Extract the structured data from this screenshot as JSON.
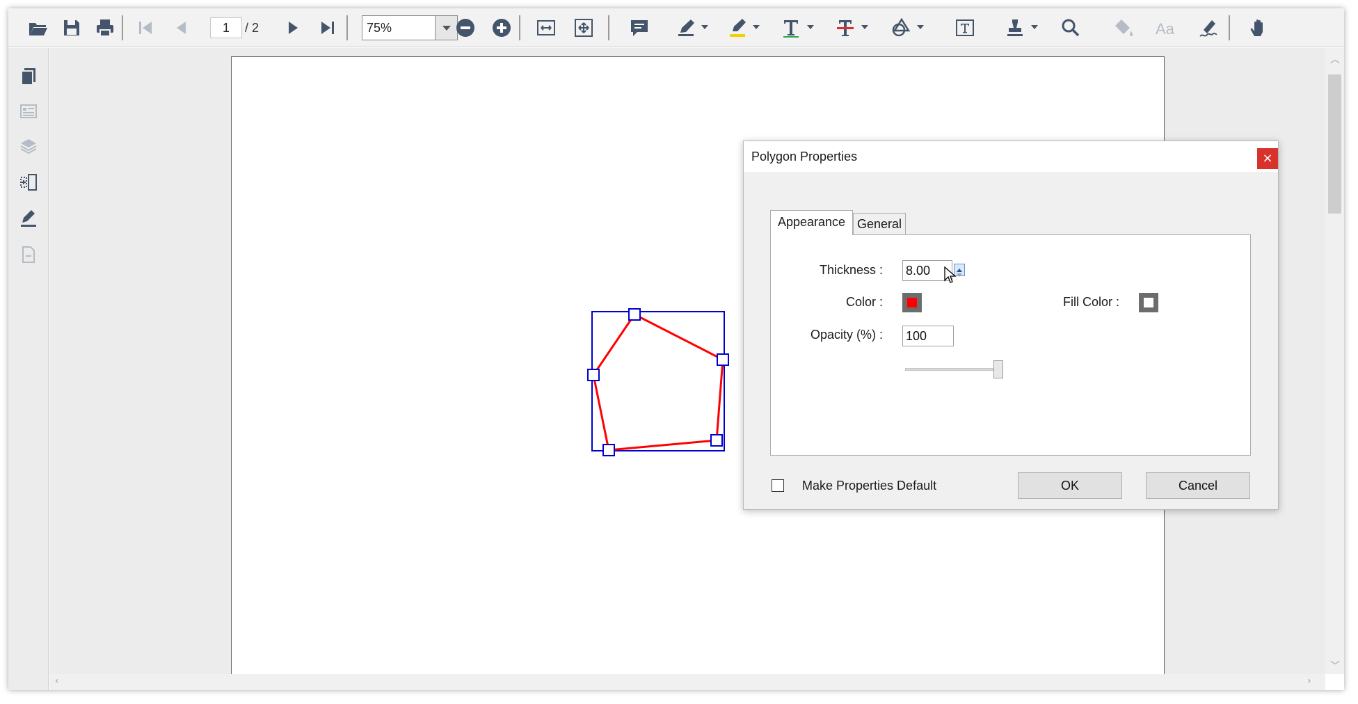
{
  "toolbar": {
    "page_current": "1",
    "page_total": "/ 2",
    "zoom": "75%"
  },
  "colors": {
    "icon": "#44546a",
    "icon_disabled": "#b5bcc6",
    "selection": "#0000cc",
    "polygon": "#ff0000",
    "close": "#d9322d"
  },
  "icons": {
    "toolbar": [
      "open-folder-icon",
      "save-icon",
      "print-icon",
      "first-page-icon",
      "previous-page-icon",
      "next-page-icon",
      "last-page-icon",
      "zoom-out-icon",
      "zoom-in-icon",
      "fit-width-icon",
      "fit-page-icon",
      "comment-icon",
      "pen-icon",
      "highlight-icon",
      "text-icon",
      "strikethrough-icon",
      "shapes-icon",
      "text-box-icon",
      "stamp-icon",
      "search-icon",
      "fill-icon",
      "font-icon",
      "signature-icon",
      "hand-icon"
    ],
    "sidebar": [
      "pages-icon",
      "bookmarks-icon",
      "layers-icon",
      "organize-pages-icon",
      "annotations-icon",
      "form-fields-icon"
    ]
  },
  "dialog": {
    "title": "Polygon Properties",
    "close_glyph": "×",
    "tabs": [
      {
        "label": "Appearance",
        "active": true
      },
      {
        "label": "General",
        "active": false
      }
    ],
    "thickness_label": "Thickness :",
    "thickness_value": "8.00",
    "color_label": "Color :",
    "color_value": "#ff0000",
    "fill_color_label": "Fill Color :",
    "fill_color_value": "#ffffff",
    "opacity_label": "Opacity (%) :",
    "opacity_value": "100",
    "opacity_slider": 1.0,
    "make_default_label": "Make Properties Default",
    "make_default_checked": false,
    "ok_label": "OK",
    "cancel_label": "Cancel"
  }
}
